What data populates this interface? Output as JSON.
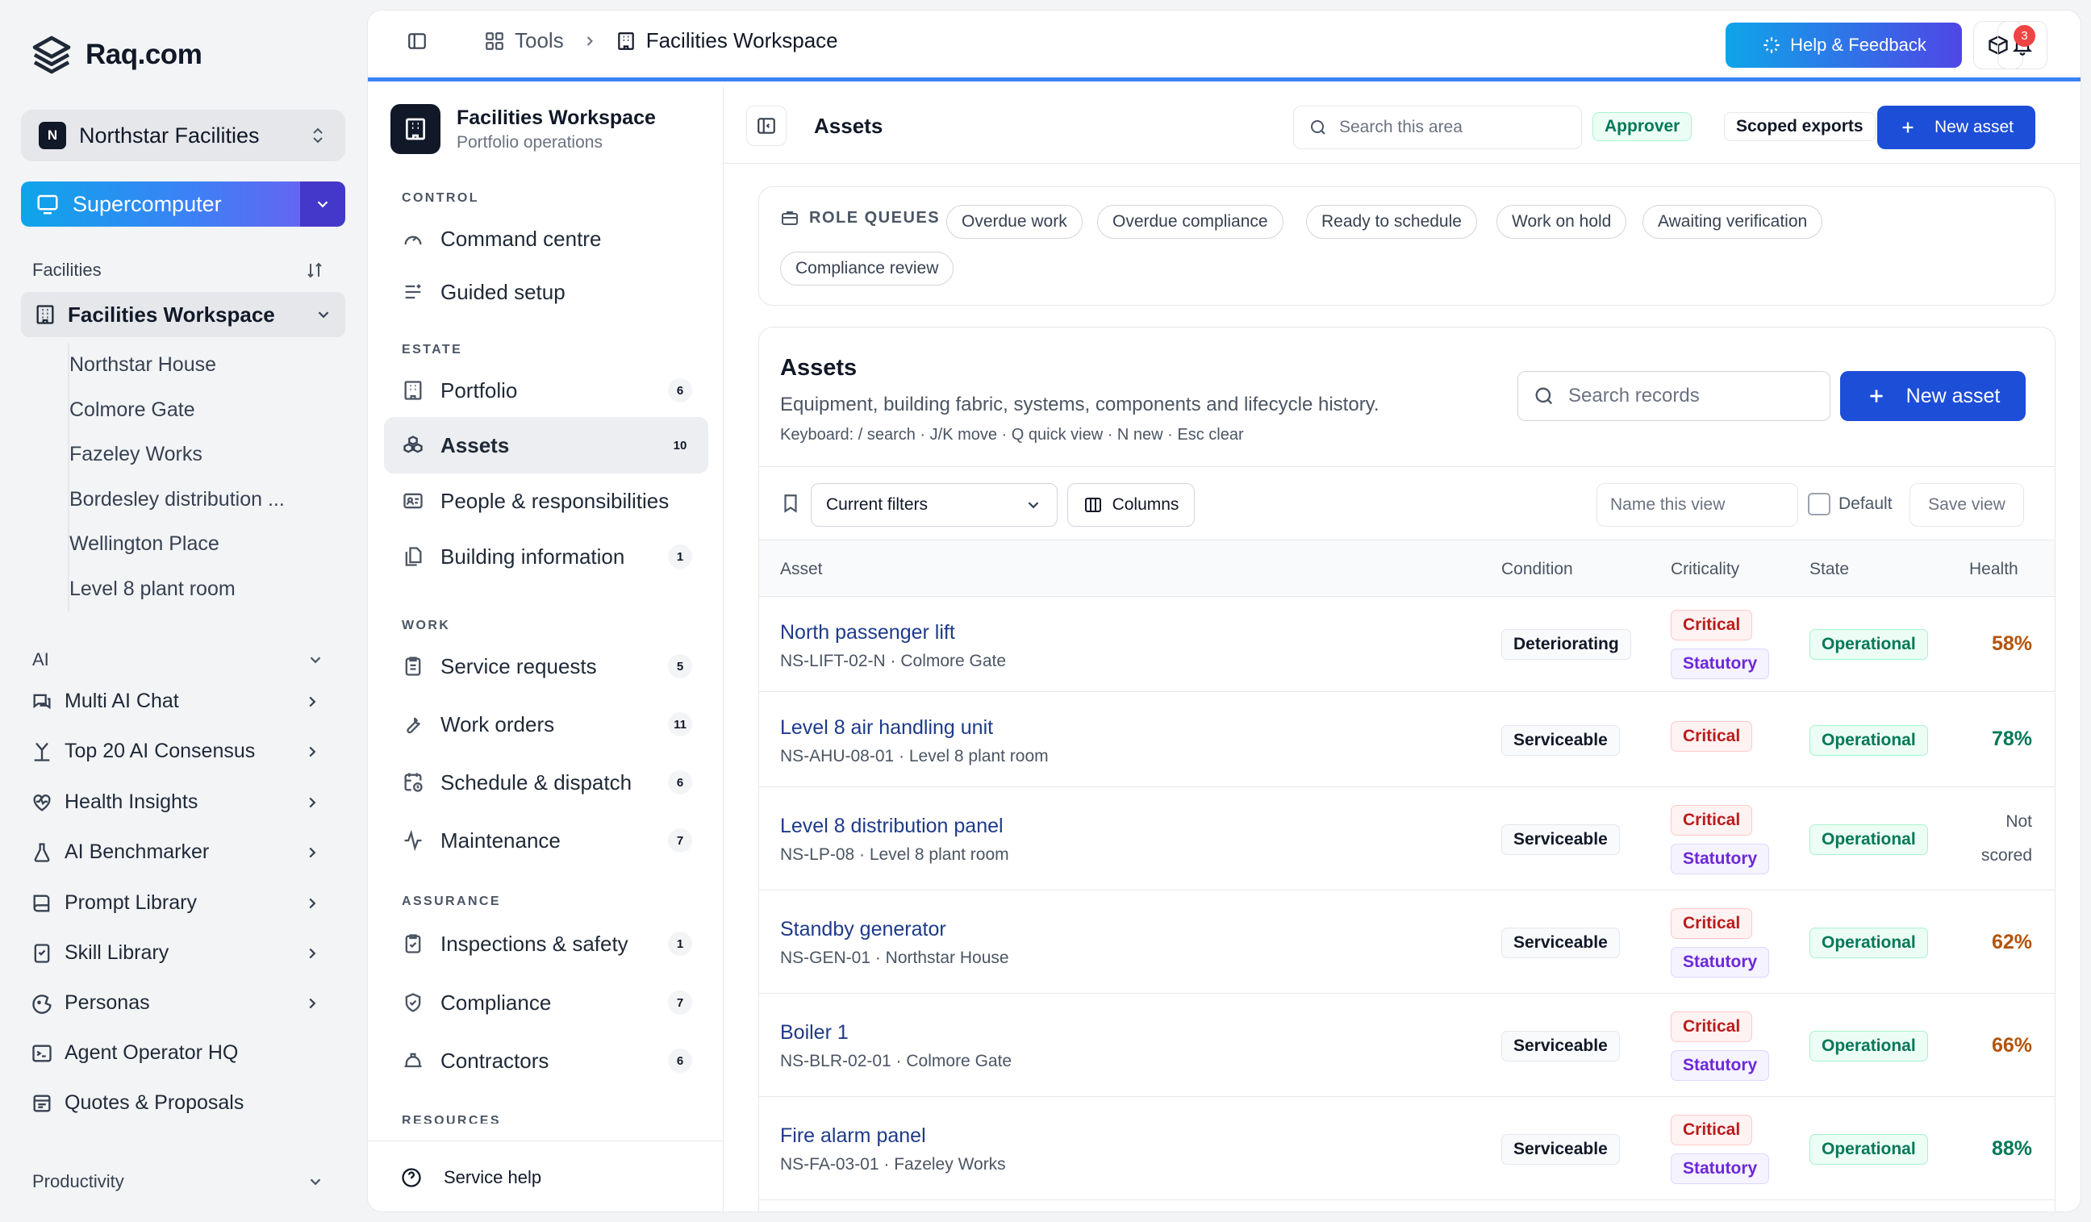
{
  "brand": {
    "name": "Raq.com"
  },
  "org": {
    "initial": "N",
    "name": "Northstar Facilities"
  },
  "supercomputer": {
    "label": "Supercomputer"
  },
  "facilities": {
    "heading": "Facilities",
    "current": "Facilities Workspace",
    "sites": [
      "Northstar House",
      "Colmore Gate",
      "Fazeley Works",
      "Bordesley distribution ...",
      "Wellington Place",
      "Level 8 plant room"
    ]
  },
  "ai": {
    "heading": "AI",
    "items": [
      {
        "label": "Multi AI Chat",
        "icon": "chat-icon",
        "chevron": true
      },
      {
        "label": "Top 20 AI Consensus",
        "icon": "merge-icon",
        "chevron": true
      },
      {
        "label": "Health Insights",
        "icon": "heart-pulse-icon",
        "chevron": true
      },
      {
        "label": "AI Benchmarker",
        "icon": "flask-icon",
        "chevron": true
      },
      {
        "label": "Prompt Library",
        "icon": "book-icon",
        "chevron": true
      },
      {
        "label": "Skill Library",
        "icon": "skill-book-icon",
        "chevron": true
      },
      {
        "label": "Personas",
        "icon": "persona-icon",
        "chevron": true
      },
      {
        "label": "Agent Operator HQ",
        "icon": "terminal-icon",
        "chevron": false
      },
      {
        "label": "Quotes & Proposals",
        "icon": "document-icon",
        "chevron": false
      }
    ]
  },
  "productivity": {
    "heading": "Productivity"
  },
  "topbar": {
    "tools": "Tools",
    "current": "Facilities Workspace",
    "help": "Help & Feedback",
    "notifications": "3"
  },
  "workspace": {
    "title": "Facilities Workspace",
    "subtitle": "Portfolio operations",
    "sections": {
      "control": "CONTROL",
      "estate": "ESTATE",
      "work": "WORK",
      "assurance": "ASSURANCE",
      "resources": "RESOURCES"
    },
    "nav": {
      "command_centre": {
        "label": "Command centre"
      },
      "guided_setup": {
        "label": "Guided setup"
      },
      "portfolio": {
        "label": "Portfolio",
        "count": "6"
      },
      "assets": {
        "label": "Assets",
        "count": "10"
      },
      "people": {
        "label": "People & responsibilities"
      },
      "building_info": {
        "label": "Building information",
        "count": "1"
      },
      "service_requests": {
        "label": "Service requests",
        "count": "5"
      },
      "work_orders": {
        "label": "Work orders",
        "count": "11"
      },
      "schedule": {
        "label": "Schedule & dispatch",
        "count": "6"
      },
      "maintenance": {
        "label": "Maintenance",
        "count": "7"
      },
      "inspections": {
        "label": "Inspections & safety",
        "count": "1"
      },
      "compliance": {
        "label": "Compliance",
        "count": "7"
      },
      "contractors": {
        "label": "Contractors",
        "count": "6"
      }
    },
    "service_help": "Service help"
  },
  "content": {
    "title": "Assets",
    "search_placeholder": "Search this area",
    "role_badge": "Approver",
    "scoped_exports": "Scoped exports",
    "new_asset": "New asset"
  },
  "role_queues": {
    "label": "ROLE QUEUES",
    "chips": [
      "Overdue work",
      "Overdue compliance",
      "Ready to schedule",
      "Work on hold",
      "Awaiting verification",
      "Compliance review"
    ]
  },
  "assets_panel": {
    "title": "Assets",
    "description": "Equipment, building fabric, systems, components and lifecycle history.",
    "shortcuts": "Keyboard: / search · J/K move · Q quick view · N new · Esc clear",
    "search_placeholder": "Search records",
    "new_asset": "New asset",
    "filters": "Current filters",
    "columns_btn": "Columns",
    "view_name_placeholder": "Name this view",
    "default_label": "Default",
    "save_view": "Save view",
    "headers": {
      "asset": "Asset",
      "condition": "Condition",
      "criticality": "Criticality",
      "state": "State",
      "health": "Health"
    },
    "rows": [
      {
        "name": "North passenger lift",
        "ref": "NS-LIFT-02-N · Colmore Gate",
        "condition": "Deteriorating",
        "criticality": [
          "Critical",
          "Statutory"
        ],
        "state": "Operational",
        "health": "58%",
        "health_level": "amber"
      },
      {
        "name": "Level 8 air handling unit",
        "ref": "NS-AHU-08-01 · Level 8 plant room",
        "condition": "Serviceable",
        "criticality": [
          "Critical"
        ],
        "state": "Operational",
        "health": "78%",
        "health_level": "green"
      },
      {
        "name": "Level 8 distribution panel",
        "ref": "NS-LP-08 · Level 8 plant room",
        "condition": "Serviceable",
        "criticality": [
          "Critical",
          "Statutory"
        ],
        "state": "Operational",
        "health": "Not scored",
        "health_level": "none"
      },
      {
        "name": "Standby generator",
        "ref": "NS-GEN-01 · Northstar House",
        "condition": "Serviceable",
        "criticality": [
          "Critical",
          "Statutory"
        ],
        "state": "Operational",
        "health": "62%",
        "health_level": "amber"
      },
      {
        "name": "Boiler 1",
        "ref": "NS-BLR-02-01 · Colmore Gate",
        "condition": "Serviceable",
        "criticality": [
          "Critical",
          "Statutory"
        ],
        "state": "Operational",
        "health": "66%",
        "health_level": "amber"
      },
      {
        "name": "Fire alarm panel",
        "ref": "NS-FA-03-01 · Fazeley Works",
        "condition": "Serviceable",
        "criticality": [
          "Critical",
          "Statutory"
        ],
        "state": "Operational",
        "health": "88%",
        "health_level": "green"
      }
    ]
  }
}
